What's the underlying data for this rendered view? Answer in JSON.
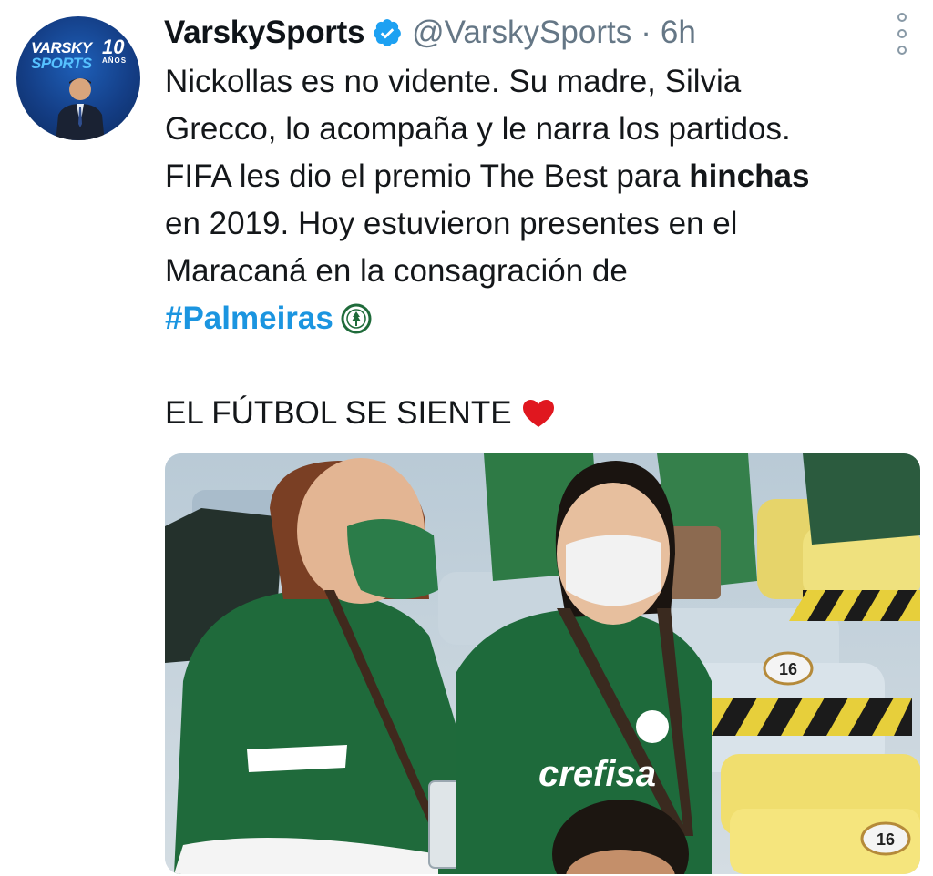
{
  "tweet": {
    "display_name": "VarskySports",
    "handle": "@VarskySports",
    "separator": "·",
    "timestamp": "6h",
    "text_lines": {
      "l1": "Nickollas es no vidente. Su madre, Silvia",
      "l2": "Grecco, lo acompaña y le narra los partidos.",
      "l3a": "FIFA les dio el premio The Best para ",
      "l3b": "hinchas",
      "l4": "en 2019. Hoy estuvieron presentes en el",
      "l5": "Maracaná en la consagración de",
      "hashtag": "#Palmeiras",
      "l7": "EL FÚTBOL SE SIENTE"
    },
    "icons": {
      "verified": "verified-badge-icon",
      "more": "more-options-icon",
      "emoji_crest": "palmeiras-crest-emoji",
      "emoji_heart": "red-heart-emoji"
    }
  },
  "avatar": {
    "brand_line1": "VARSKY",
    "brand_line2": "SPORTS",
    "badge_number": "10",
    "badge_word": "AÑOS"
  },
  "media": {
    "seat_number_1": "16",
    "seat_number_2": "16",
    "shirt_text": "crefisa"
  },
  "colors": {
    "link": "#1b95e0",
    "muted": "#657786",
    "verified": "#1da1f2",
    "heart": "#e0171f",
    "palmeiras_green": "#1f6b3a"
  }
}
